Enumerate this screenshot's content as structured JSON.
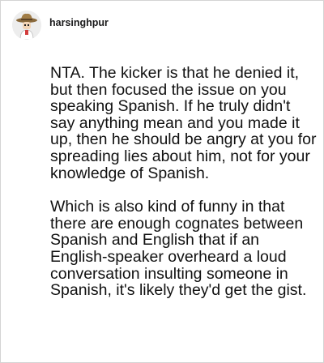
{
  "post": {
    "username": "harsinghpur",
    "avatar_icon": "cowboy-avatar-icon",
    "paragraphs": [
      "NTA. The kicker is that he denied it, but then focused the issue on you speaking Spanish. If he truly didn't say anything mean and you made it up, then he should be angry at you for spreading lies about him, not for your knowledge of Spanish.",
      "Which is also kind of funny in that there are enough cognates between Spanish and English that if an English-speaker overheard a loud conversation insulting someone in Spanish, it's likely they'd get the gist."
    ]
  }
}
